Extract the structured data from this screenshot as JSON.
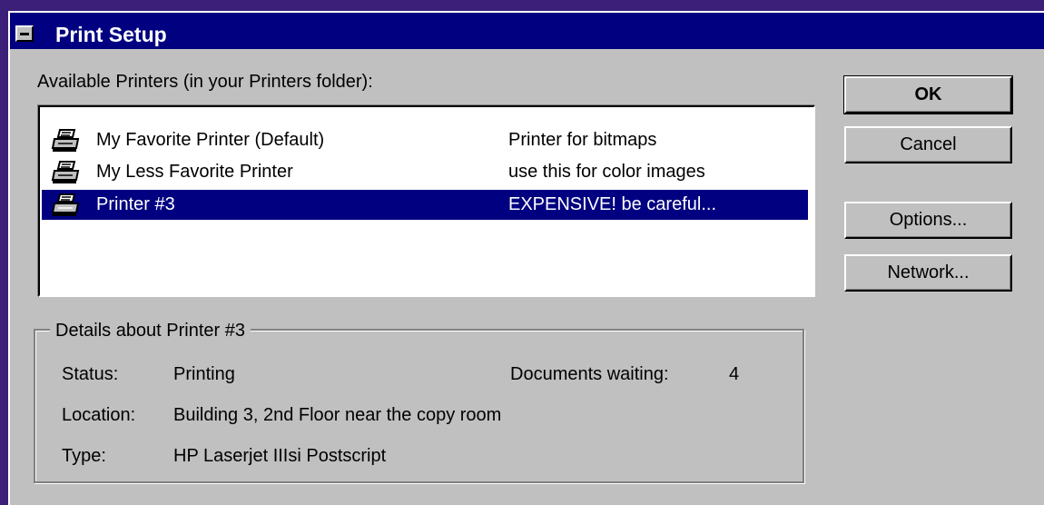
{
  "window": {
    "title": "Print Setup"
  },
  "printers_label": "Available Printers (in your Printers folder):",
  "printers": [
    {
      "name": "My Favorite Printer (Default)",
      "description": "Printer for bitmaps",
      "selected": false
    },
    {
      "name": "My Less Favorite Printer",
      "description": "use this for color images",
      "selected": false
    },
    {
      "name": "Printer #3",
      "description": "EXPENSIVE! be careful...",
      "selected": true
    }
  ],
  "buttons": {
    "ok": "OK",
    "cancel": "Cancel",
    "options": "Options...",
    "network": "Network..."
  },
  "details": {
    "legend": "Details about Printer #3",
    "status_label": "Status:",
    "status_value": "Printing",
    "docs_label": "Documents waiting:",
    "docs_value": "4",
    "location_label": "Location:",
    "location_value": "Building 3, 2nd Floor near the copy room",
    "type_label": "Type:",
    "type_value": "HP Laserjet IIIsi Postscript"
  },
  "colors": {
    "titlebar": "#000080",
    "selection": "#000080",
    "dialog_face": "#c0c0c0",
    "background": "#3c1f78"
  },
  "icons": {
    "system_menu": "system-menu-icon",
    "printer": "printer-icon"
  }
}
